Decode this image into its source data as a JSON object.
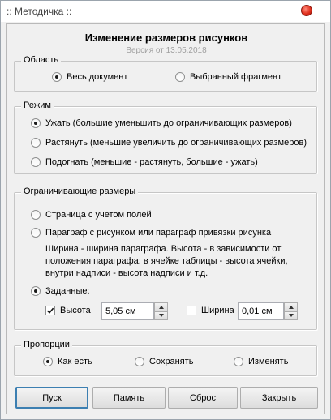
{
  "window": {
    "title": ":: Методичка ::",
    "heading": "Изменение размеров рисунков",
    "version": "Версия от 13.05.2018"
  },
  "area": {
    "legend": "Область",
    "options": [
      "Весь документ",
      "Выбранный фрагмент"
    ],
    "selected": 0
  },
  "mode": {
    "legend": "Режим",
    "options": [
      "Ужать (большие уменьшить до ограничивающих размеров)",
      "Растянуть (меньшие увеличить до ограничивающих размеров)",
      "Подогнать (меньшие - растянуть, большие - ужать)"
    ],
    "selected": 0
  },
  "limits": {
    "legend": "Ограничивающие размеры",
    "options": [
      "Страница с учетом полей",
      "Параграф с рисунком или параграф привязки рисунка",
      "Заданные:"
    ],
    "selected": 2,
    "note_lines": [
      "Ширина - ширина параграфа. Высота - в зависимости от",
      "положения параграфа: в ячейке таблицы - высота ячейки,",
      "внутри надписи - высота надписи и т.д."
    ],
    "height_label": "Высота",
    "height_checked": true,
    "height_value": "5,05 см",
    "width_label": "Ширина",
    "width_checked": false,
    "width_value": "0,01 см"
  },
  "proportions": {
    "legend": "Пропорции",
    "options": [
      "Как есть",
      "Сохранять",
      "Изменять"
    ],
    "selected": 0
  },
  "buttons": {
    "run": "Пуск",
    "memory": "Память",
    "reset": "Сброс",
    "close": "Закрыть"
  },
  "colors": {
    "accent_border": "#3c7fb1",
    "close_button": "#e0301e"
  }
}
